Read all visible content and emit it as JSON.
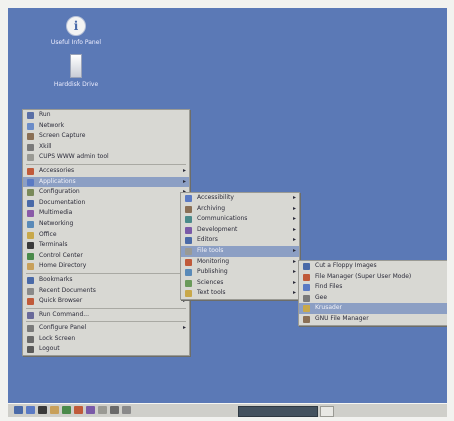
{
  "desktop": {
    "background": "#5b79b6",
    "icons": [
      {
        "label": "Useful Info Panel",
        "icon": "info-icon"
      },
      {
        "label": "Harddisk Drive",
        "icon": "drive-icon"
      }
    ]
  },
  "main_menu": {
    "items": [
      {
        "type": "item",
        "label": "Run",
        "icon": "run-icon",
        "color": "#5a6fa6",
        "submenu": false
      },
      {
        "type": "item",
        "label": "Network",
        "icon": "network-icon",
        "color": "#6b8cc8",
        "submenu": false
      },
      {
        "type": "item",
        "label": "Screen Capture",
        "icon": "camera-icon",
        "color": "#8a6f55",
        "submenu": false
      },
      {
        "type": "item",
        "label": "Xkill",
        "icon": "xkill-icon",
        "color": "#7a7a7a",
        "submenu": false
      },
      {
        "type": "item",
        "label": "CUPS WWW admin tool",
        "icon": "printer-icon",
        "color": "#9a9a94",
        "submenu": false
      },
      {
        "type": "separator"
      },
      {
        "type": "item",
        "label": "Accessories",
        "icon": "accessories-icon",
        "color": "#c05a3a",
        "submenu": true
      },
      {
        "type": "item",
        "label": "Applications",
        "icon": "applications-icon",
        "color": "#5a7ac4",
        "submenu": true,
        "highlighted": true
      },
      {
        "type": "item",
        "label": "Configuration",
        "icon": "configuration-icon",
        "color": "#7a8a5a",
        "submenu": true
      },
      {
        "type": "item",
        "label": "Documentation",
        "icon": "documentation-icon",
        "color": "#4a6aa8",
        "submenu": true
      },
      {
        "type": "item",
        "label": "Multimedia",
        "icon": "multimedia-icon",
        "color": "#8a5aa8",
        "submenu": true
      },
      {
        "type": "item",
        "label": "Networking",
        "icon": "networking-icon",
        "color": "#5a8ab8",
        "submenu": true
      },
      {
        "type": "item",
        "label": "Office",
        "icon": "office-icon",
        "color": "#c8a84a",
        "submenu": true
      },
      {
        "type": "item",
        "label": "Terminals",
        "icon": "terminal-icon",
        "color": "#3a3a3a",
        "submenu": true
      },
      {
        "type": "item",
        "label": "Control Center",
        "icon": "control-center-icon",
        "color": "#4a8a4a",
        "submenu": false
      },
      {
        "type": "item",
        "label": "Home Directory",
        "icon": "home-icon",
        "color": "#c8a05a",
        "submenu": false
      },
      {
        "type": "separator"
      },
      {
        "type": "item",
        "label": "Bookmarks",
        "icon": "bookmark-icon",
        "color": "#4a6aa8",
        "submenu": true
      },
      {
        "type": "item",
        "label": "Recent Documents",
        "icon": "recent-documents-icon",
        "color": "#8a8a8a",
        "submenu": true
      },
      {
        "type": "item",
        "label": "Quick Browser",
        "icon": "quick-browser-icon",
        "color": "#c05a3a",
        "submenu": true
      },
      {
        "type": "separator"
      },
      {
        "type": "item",
        "label": "Run Command...",
        "icon": "run-command-icon",
        "color": "#6a6a9a",
        "submenu": false
      },
      {
        "type": "separator"
      },
      {
        "type": "item",
        "label": "Configure Panel",
        "icon": "configure-panel-icon",
        "color": "#7a7a7a",
        "submenu": true
      },
      {
        "type": "item",
        "label": "Lock Screen",
        "icon": "lock-icon",
        "color": "#6a6a6a",
        "submenu": false
      },
      {
        "type": "item",
        "label": "Logout",
        "icon": "logout-icon",
        "color": "#5a5a5a",
        "submenu": false
      }
    ]
  },
  "applications_menu": {
    "items": [
      {
        "label": "Accessibility",
        "icon": "accessibility-icon",
        "color": "#5a7ac4",
        "submenu": true
      },
      {
        "label": "Archiving",
        "icon": "archive-icon",
        "color": "#8a6f55",
        "submenu": true
      },
      {
        "label": "Communications",
        "icon": "communications-icon",
        "color": "#4a8a8a",
        "submenu": true
      },
      {
        "label": "Development",
        "icon": "development-icon",
        "color": "#7a5aa8",
        "submenu": true
      },
      {
        "label": "Editors",
        "icon": "editors-icon",
        "color": "#4a6aa8",
        "submenu": true
      },
      {
        "label": "File tools",
        "icon": "file-tools-icon",
        "color": "#9a9a94",
        "submenu": true,
        "highlighted": true
      },
      {
        "label": "Monitoring",
        "icon": "monitoring-icon",
        "color": "#c05a3a",
        "submenu": true
      },
      {
        "label": "Publishing",
        "icon": "publishing-icon",
        "color": "#5a8ab8",
        "submenu": true
      },
      {
        "label": "Sciences",
        "icon": "sciences-icon",
        "color": "#6a9a5a",
        "submenu": true
      },
      {
        "label": "Text tools",
        "icon": "text-tools-icon",
        "color": "#c8a84a",
        "submenu": true
      }
    ]
  },
  "file_tools_menu": {
    "items": [
      {
        "label": "Cut a Floppy Images",
        "icon": "floppy-icon",
        "color": "#4a6aa8"
      },
      {
        "label": "File Manager (Super User Mode)",
        "icon": "file-manager-su-icon",
        "color": "#c05a3a"
      },
      {
        "label": "Find Files",
        "icon": "find-icon",
        "color": "#5a7ac4"
      },
      {
        "label": "Gee",
        "icon": "gee-icon",
        "color": "#7a7a7a"
      },
      {
        "label": "Krusader",
        "icon": "krusader-icon",
        "color": "#c8a84a",
        "highlighted": true
      },
      {
        "label": "GNU File Manager",
        "icon": "gnu-file-manager-icon",
        "color": "#8a6f55"
      }
    ]
  },
  "taskbar": {
    "launchers": [
      {
        "icon": "start-icon",
        "color": "#4a6aa8"
      },
      {
        "icon": "desktop-icon",
        "color": "#5a7ac4"
      },
      {
        "icon": "terminal-icon",
        "color": "#3a3a3a"
      },
      {
        "icon": "home-icon",
        "color": "#c8a05a"
      },
      {
        "icon": "browser-icon",
        "color": "#4a8a4a"
      },
      {
        "icon": "mail-icon",
        "color": "#c05a3a"
      },
      {
        "icon": "office-icon",
        "color": "#7a5aa8"
      },
      {
        "icon": "help-icon",
        "color": "#9a9a94"
      },
      {
        "icon": "tools-icon",
        "color": "#6a6a6a"
      },
      {
        "icon": "pager-icon",
        "color": "#8a8a8a"
      }
    ],
    "task_color": "#44525f"
  }
}
